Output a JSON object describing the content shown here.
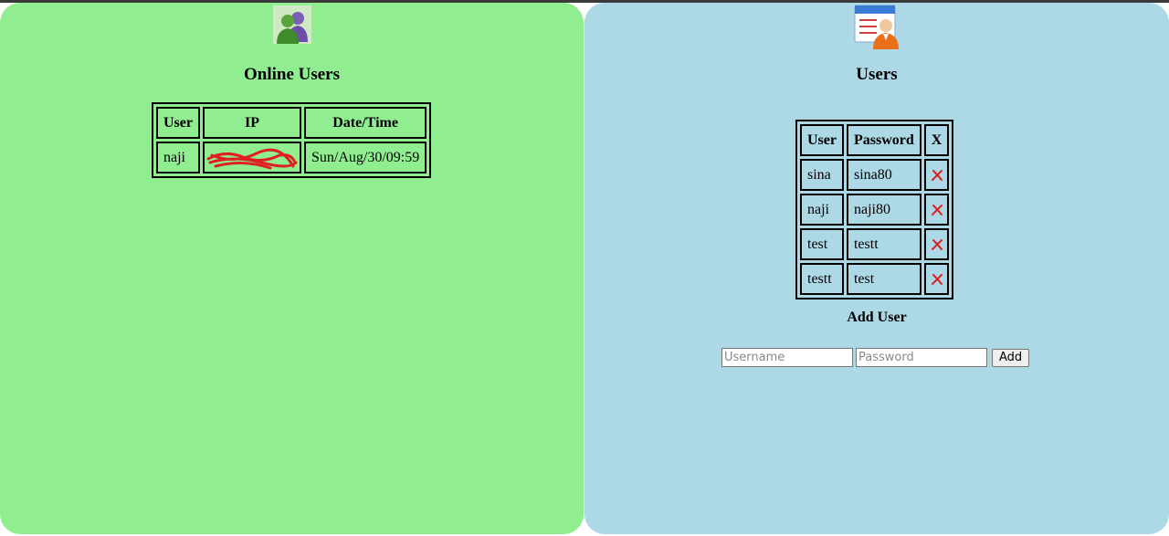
{
  "online": {
    "icon": "online-users-icon",
    "title": "Online Users",
    "columns": [
      "User",
      "IP",
      "Date/Time"
    ],
    "rows": [
      {
        "user": "naji",
        "ip": "[redacted]",
        "datetime": "Sun/Aug/30/09:59"
      }
    ]
  },
  "users": {
    "icon": "user-contact-card-icon",
    "title": "Users",
    "columns": [
      "User",
      "Password",
      "X"
    ],
    "rows": [
      {
        "user": "sina",
        "password": "sina80"
      },
      {
        "user": "naji",
        "password": "naji80"
      },
      {
        "user": "test",
        "password": "testt"
      },
      {
        "user": "testt",
        "password": "test"
      }
    ],
    "delete_icon": "delete-x-icon"
  },
  "add_user": {
    "title": "Add User",
    "username_placeholder": "Username",
    "password_placeholder": "Password",
    "button_label": "Add"
  },
  "colors": {
    "left_panel": "#90ee90",
    "right_panel": "#add8e6",
    "delete_x": "#e02020"
  }
}
